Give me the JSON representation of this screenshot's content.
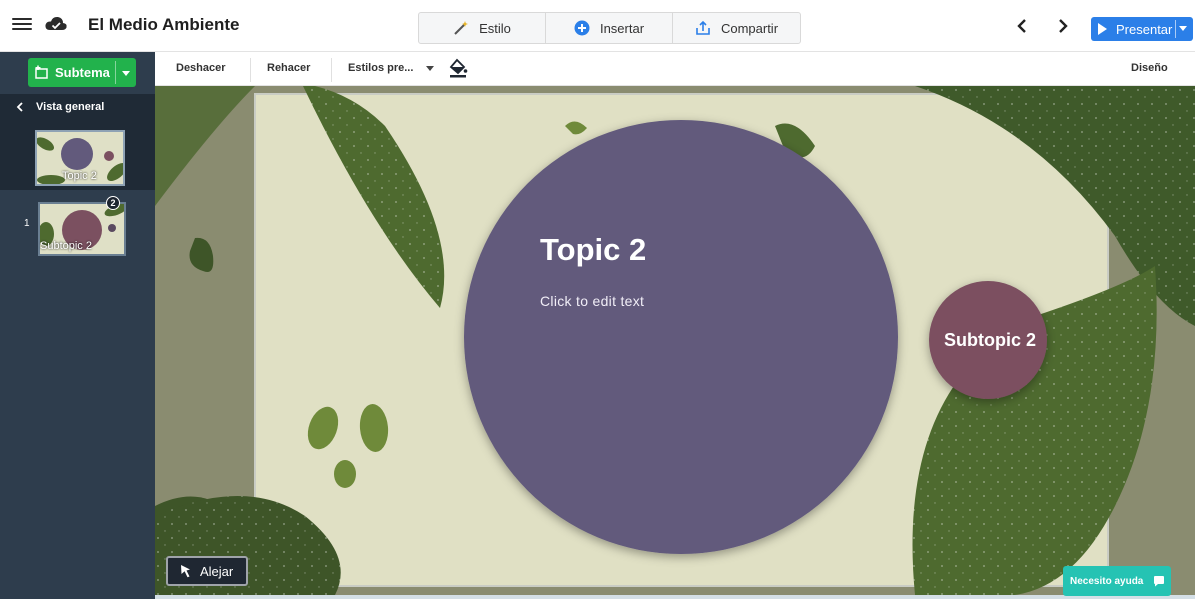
{
  "header": {
    "title": "El Medio Ambiente",
    "tabs": [
      {
        "label": "Estilo",
        "icon": "magic-wand-icon"
      },
      {
        "label": "Insertar",
        "icon": "plus-circle-icon"
      },
      {
        "label": "Compartir",
        "icon": "share-upload-icon"
      }
    ],
    "present_label": "Presentar"
  },
  "toolbar": {
    "undo": "Deshacer",
    "redo": "Rehacer",
    "preset_styles": "Estilos pre...",
    "design": "Diseño"
  },
  "sidebar": {
    "add_subtopic": "Subtema",
    "overview": "Vista general",
    "thumbnails": [
      {
        "label": "Topic 2",
        "active": true
      },
      {
        "number": "1",
        "label": "Subtopic 2",
        "badge": "2"
      }
    ]
  },
  "canvas": {
    "topic_title": "Topic 2",
    "topic_body": "Click to edit text",
    "subtopic_label": "Subtopic 2",
    "colors": {
      "background": "#e0e0c4",
      "leaf": "#4e6a2f",
      "topic_circle": "#625a7c",
      "subtopic_circle": "#7b5060"
    }
  },
  "zoom_out": "Alejar",
  "help": "Necesito ayuda",
  "accent_colors": {
    "present": "#2b7fe8",
    "subtema": "#22b24c",
    "help": "#25c3b3"
  }
}
